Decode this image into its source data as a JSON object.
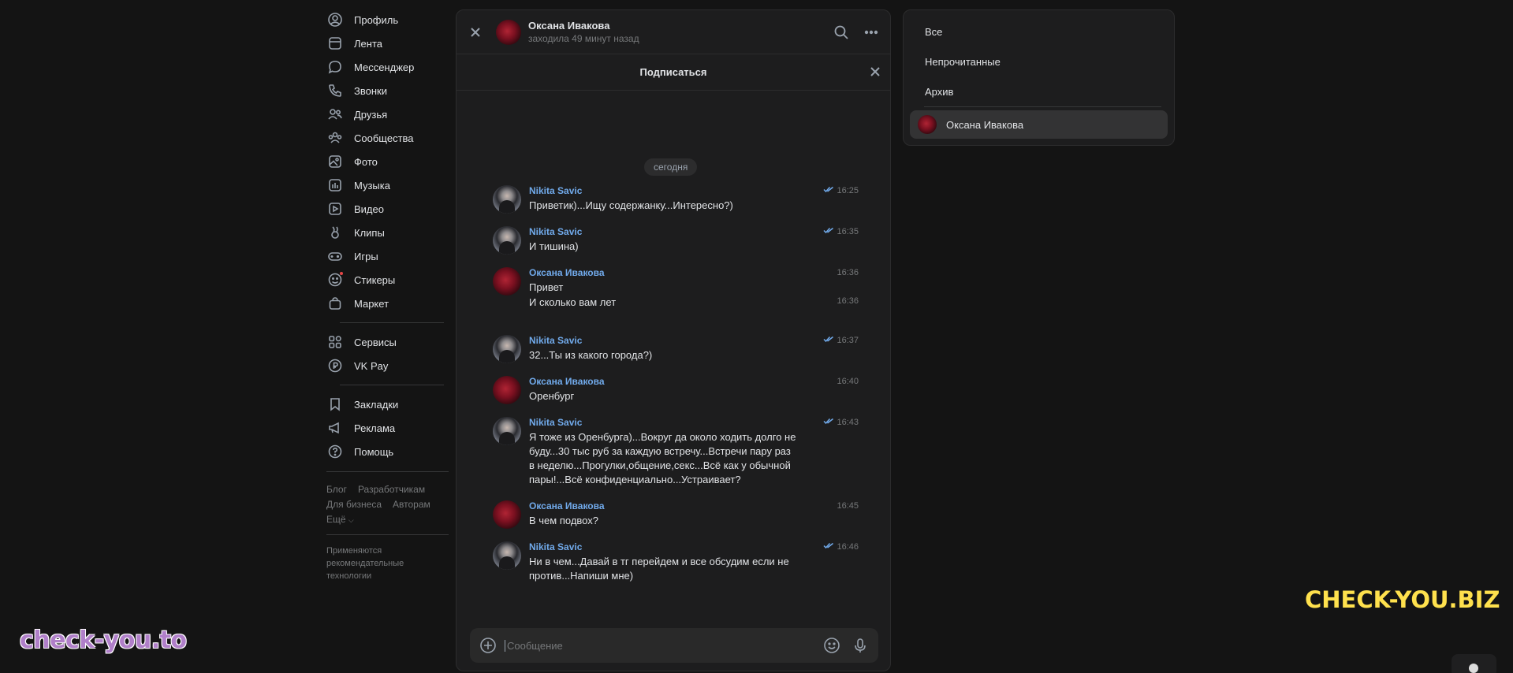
{
  "nav": {
    "items": [
      {
        "label": "Профиль",
        "icon": "user-circle-icon"
      },
      {
        "label": "Лента",
        "icon": "newsfeed-icon"
      },
      {
        "label": "Мессенджер",
        "icon": "message-icon"
      },
      {
        "label": "Звонки",
        "icon": "phone-icon"
      },
      {
        "label": "Друзья",
        "icon": "friends-icon"
      },
      {
        "label": "Сообщества",
        "icon": "communities-icon"
      },
      {
        "label": "Фото",
        "icon": "photo-icon"
      },
      {
        "label": "Музыка",
        "icon": "music-icon"
      },
      {
        "label": "Видео",
        "icon": "video-icon"
      },
      {
        "label": "Клипы",
        "icon": "clips-icon"
      },
      {
        "label": "Игры",
        "icon": "games-icon"
      },
      {
        "label": "Стикеры",
        "icon": "stickers-icon"
      },
      {
        "label": "Маркет",
        "icon": "market-icon"
      }
    ],
    "items2": [
      {
        "label": "Сервисы",
        "icon": "services-icon"
      },
      {
        "label": "VK Pay",
        "icon": "vkpay-icon"
      }
    ],
    "items3": [
      {
        "label": "Закладки",
        "icon": "bookmark-icon"
      },
      {
        "label": "Реклама",
        "icon": "ads-icon"
      },
      {
        "label": "Помощь",
        "icon": "help-icon"
      }
    ],
    "footer": {
      "blog": "Блог",
      "developers": "Разработчикам",
      "business": "Для бизнеса",
      "authors": "Авторам",
      "more": "Ещё",
      "note": "Применяются рекомендательные технологии"
    }
  },
  "chat": {
    "name": "Оксана Ивакова",
    "status": "заходила 49 минут назад",
    "subscribe": "Подписаться",
    "date": "сегодня",
    "messages": [
      {
        "author": "Nikita Savic",
        "text": "Приветик)...Ищу содержанку...Интересно?)",
        "time": "16:25",
        "read": true,
        "avatar": "nikita"
      },
      {
        "author": "Nikita Savic",
        "text": "И тишина)",
        "time": "16:35",
        "read": true,
        "avatar": "nikita"
      },
      {
        "author": "Оксана Ивакова",
        "text": "Привет",
        "time": "16:36",
        "read": false,
        "avatar": "oksana"
      },
      {
        "author": "",
        "text": "И сколько вам лет",
        "time": "16:36",
        "read": false,
        "avatar": ""
      },
      {
        "author": "Nikita Savic",
        "text": "32...Ты из какого города?)",
        "time": "16:37",
        "read": true,
        "avatar": "nikita"
      },
      {
        "author": "Оксана Ивакова",
        "text": "Оренбург",
        "time": "16:40",
        "read": false,
        "avatar": "oksana"
      },
      {
        "author": "Nikita Savic",
        "text": "Я тоже из Оренбурга)...Вокруг да около ходить долго не буду...30 тыс руб за каждую встречу...Встречи пару раз в неделю...Прогулки,общение,секс...Всё как у обычной пары!...Всё конфиденциально...Устраивает?",
        "time": "16:43",
        "read": true,
        "avatar": "nikita"
      },
      {
        "author": "Оксана Ивакова",
        "text": "В чем подвох?",
        "time": "16:45",
        "read": false,
        "avatar": "oksana"
      },
      {
        "author": "Nikita Savic",
        "text": "Ни в чем...Давай в тг перейдем и все обсудим если не против...Напиши мне)",
        "time": "16:46",
        "read": true,
        "avatar": "nikita"
      }
    ],
    "composer_placeholder": "Сообщение"
  },
  "filters": {
    "all": "Все",
    "unread": "Непрочитанные",
    "archive": "Архив",
    "active_chat": "Оксана Ивакова"
  },
  "watermarks": {
    "left": "check-you.to",
    "right": "CHECK-YOU.BIZ"
  },
  "colors": {
    "accent": "#71aaeb",
    "background": "#141414",
    "panel": "#1d1d1e"
  }
}
